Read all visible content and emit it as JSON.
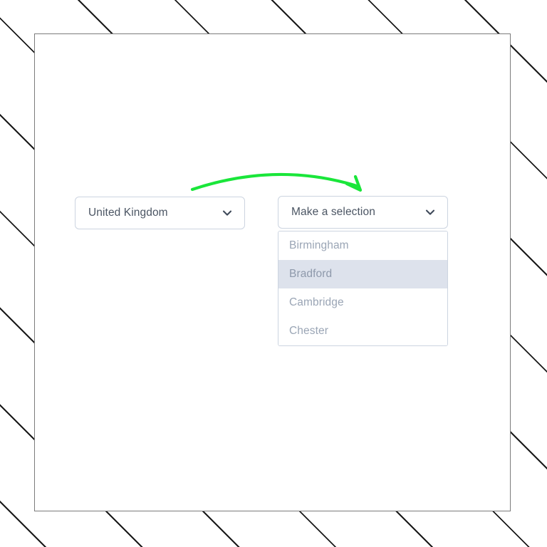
{
  "canvas": {
    "background_style": "diagonal-hatch",
    "hatch_color": "#1a1a1a",
    "frame_border_color": "#7b7b7b"
  },
  "annotation": {
    "arrow_color": "#1ae63a",
    "arrow_label": "curved-arrow-from-country-to-city"
  },
  "form": {
    "country_select": {
      "name": "country-select",
      "value": "United Kingdom",
      "placeholder": "Make a selection",
      "icon": "chevron-down-icon",
      "expanded": false
    },
    "city_select": {
      "name": "city-select",
      "value": "Make a selection",
      "placeholder": "Make a selection",
      "icon": "chevron-down-icon",
      "expanded": true,
      "options": [
        {
          "label": "Birmingham",
          "highlighted": false
        },
        {
          "label": "Bradford",
          "highlighted": true
        },
        {
          "label": "Cambridge",
          "highlighted": false
        },
        {
          "label": "Chester",
          "highlighted": false
        }
      ]
    }
  },
  "colors": {
    "select_border": "#ccd4e0",
    "select_text": "#4b5563",
    "option_text": "#9aa5b5",
    "option_highlight_bg": "#dde2ec",
    "accent_green": "#1ae63a"
  }
}
